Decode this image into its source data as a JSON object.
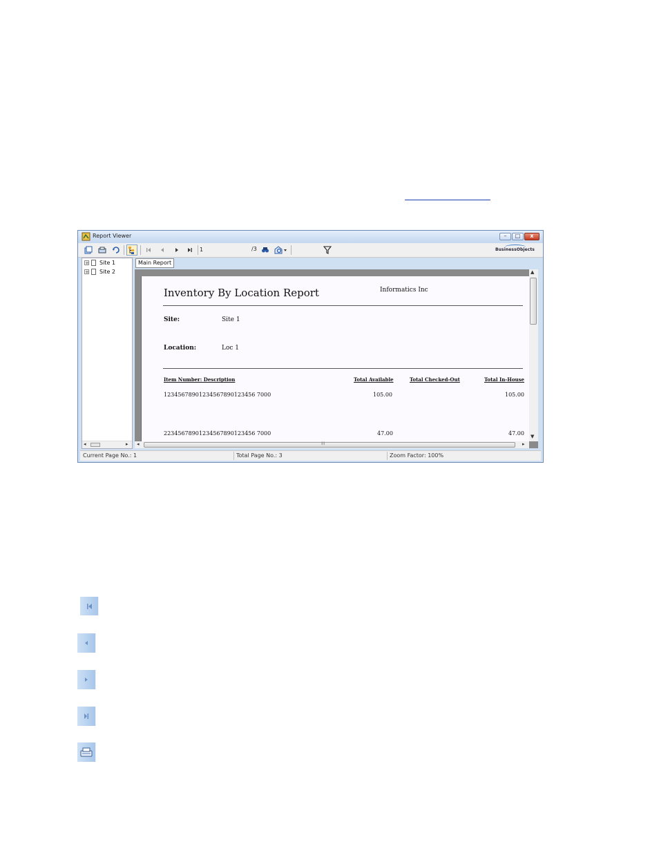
{
  "window": {
    "title": "Report Viewer",
    "buttons": {
      "minimize": "–",
      "maximize": "□",
      "close": "x"
    }
  },
  "toolbar": {
    "page_input": "1",
    "page_total": "/3",
    "brand": "BusinessObjects"
  },
  "tree": {
    "items": [
      {
        "expander": "+",
        "label": "Site 1"
      },
      {
        "expander": "+",
        "label": "Site 2"
      }
    ]
  },
  "tab": {
    "label": "Main Report"
  },
  "report": {
    "title": "Inventory By Location Report",
    "company": "Informatics Inc",
    "site_label": "Site:",
    "site_value": "Site 1",
    "location_label": "Location:",
    "location_value": "Loc 1",
    "columns": [
      "Item Number: Description",
      "Total Available",
      "Total Checked-Out",
      "Total In-House"
    ],
    "rows": [
      {
        "item": "12345678901234567890123456 7000",
        "available": "105.00",
        "checked_out": "",
        "in_house": "105.00"
      },
      {
        "item": "22345678901234567890123456 7000",
        "available": "47.00",
        "checked_out": "",
        "in_house": "47.00"
      }
    ]
  },
  "status": {
    "current_page": "Current Page No.: 1",
    "total_page": "Total Page No.: 3",
    "zoom": "Zoom Factor: 100%"
  },
  "icons": {
    "big": [
      "first-page-icon",
      "previous-page-icon",
      "next-page-icon",
      "last-page-icon",
      "print-icon"
    ]
  }
}
